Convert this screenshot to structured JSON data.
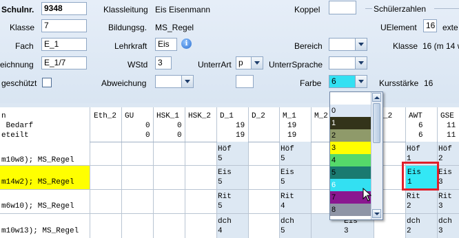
{
  "form": {
    "schulnr_label": "Schulnr.",
    "schulnr_value": "9348",
    "klassenleitung_label": "Klassleitung",
    "klassenleitung_value": "Eis Eisenmann",
    "koppel_label": "Koppel",
    "schuelerzahlen_label": "Schülerzahlen",
    "klasse_label": "Klasse",
    "klasse_value": "7",
    "bildungsg_label": "Bildungsg.",
    "bildungsg_value": "MS_Regel",
    "uelement_label": "UElement",
    "uelement_value": "16",
    "uelement_extra": "exte",
    "fach_label": "Fach",
    "fach_value": "E_1",
    "lehrkraft_label": "Lehrkraft",
    "lehrkraft_value": "Eis",
    "bereich_label": "Bereich",
    "klasse2_label": "Klasse",
    "klasse2_value": "16 (m 14 w",
    "bezeichnung_label": "eichnung",
    "bezeichnung_value": "E_1/7",
    "wstd_label": "WStd",
    "wstd_value": "3",
    "unterrart_label": "UnterrArt",
    "unterrart_value": "p",
    "unterrsprache_label": "UnterrSprache",
    "geschuetzt_label": "geschützt",
    "abweichung_label": "Abweichung",
    "farbe_label": "Farbe",
    "farbe_value": "6",
    "kursstaerke_label": "Kursstärke",
    "kursstaerke_value": "16",
    "info_icon": "info-icon"
  },
  "grid": {
    "header_left": [
      "n",
      " Bedarf",
      "eteilt"
    ],
    "columns": [
      {
        "name": "Eth_2",
        "bedarf": "",
        "zugeteilt": ""
      },
      {
        "name": "GU",
        "bedarf": "0",
        "zugeteilt": "0"
      },
      {
        "name": "HSK_1",
        "bedarf": "0",
        "zugeteilt": "0"
      },
      {
        "name": "HSK_2",
        "bedarf": "",
        "zugeteilt": ""
      },
      {
        "name": "D_1",
        "bedarf": "19",
        "zugeteilt": "19"
      },
      {
        "name": "D_2",
        "bedarf": "",
        "zugeteilt": ""
      },
      {
        "name": "M_1",
        "bedarf": "19",
        "zugeteilt": "19"
      },
      {
        "name": "M_2",
        "bedarf": "",
        "zugeteilt": ""
      },
      {
        "name": "_2",
        "bedarf": "",
        "zugeteilt": ""
      },
      {
        "name": "AWT",
        "bedarf": "6",
        "zugeteilt": "6"
      },
      {
        "name": "GSE",
        "bedarf": "11",
        "zugeteilt": "11"
      }
    ],
    "rows": [
      {
        "label": "m10w8); MS_Regel",
        "d1": [
          "Höf",
          "5"
        ],
        "m1": [
          "Höf",
          "5"
        ],
        "m2": [
          "",
          ""
        ],
        "awt": [
          "Höf",
          "1"
        ],
        "gse": [
          "Höf",
          "2"
        ]
      },
      {
        "label": "m14w2); MS_Regel",
        "d1": [
          "Eis",
          "5"
        ],
        "m1": [
          "Eis",
          "5"
        ],
        "m2": [
          "",
          ""
        ],
        "awt": [
          "Eis",
          "1"
        ],
        "gse": [
          "Eis",
          "3"
        ]
      },
      {
        "label": "m6w10); MS_Regel",
        "d1": [
          "Rit",
          "5"
        ],
        "m1": [
          "Rit",
          "4"
        ],
        "m2": [
          "",
          ""
        ],
        "awt": [
          "Rit",
          "2"
        ],
        "gse": [
          "Rit",
          "3"
        ]
      },
      {
        "label": "m10w13); MS_Regel",
        "d1": [
          "dch",
          "4"
        ],
        "m1": [
          "dch",
          "5"
        ],
        "m2": [
          "Eis",
          "3"
        ],
        "awt": [
          "dch",
          "2"
        ],
        "gse": [
          "dch",
          "3"
        ]
      }
    ]
  },
  "dropdown": {
    "options": [
      {
        "label": "0",
        "color": "#dbe6f4"
      },
      {
        "label": "1",
        "color": "#33331a"
      },
      {
        "label": "2",
        "color": "#8f9a6a"
      },
      {
        "label": "3",
        "color": "#ffff00"
      },
      {
        "label": "4",
        "color": "#55d96a"
      },
      {
        "label": "5",
        "color": "#1a7a70"
      },
      {
        "label": "6",
        "color": "#33e0f2"
      },
      {
        "label": "7",
        "color": "#8a1790"
      },
      {
        "label": "8",
        "color": "#8f95a6"
      }
    ]
  },
  "colors": {
    "highlight_row": "#ffff00",
    "selected_cell": "#33e8f5",
    "focus_box": "#e0202a"
  }
}
